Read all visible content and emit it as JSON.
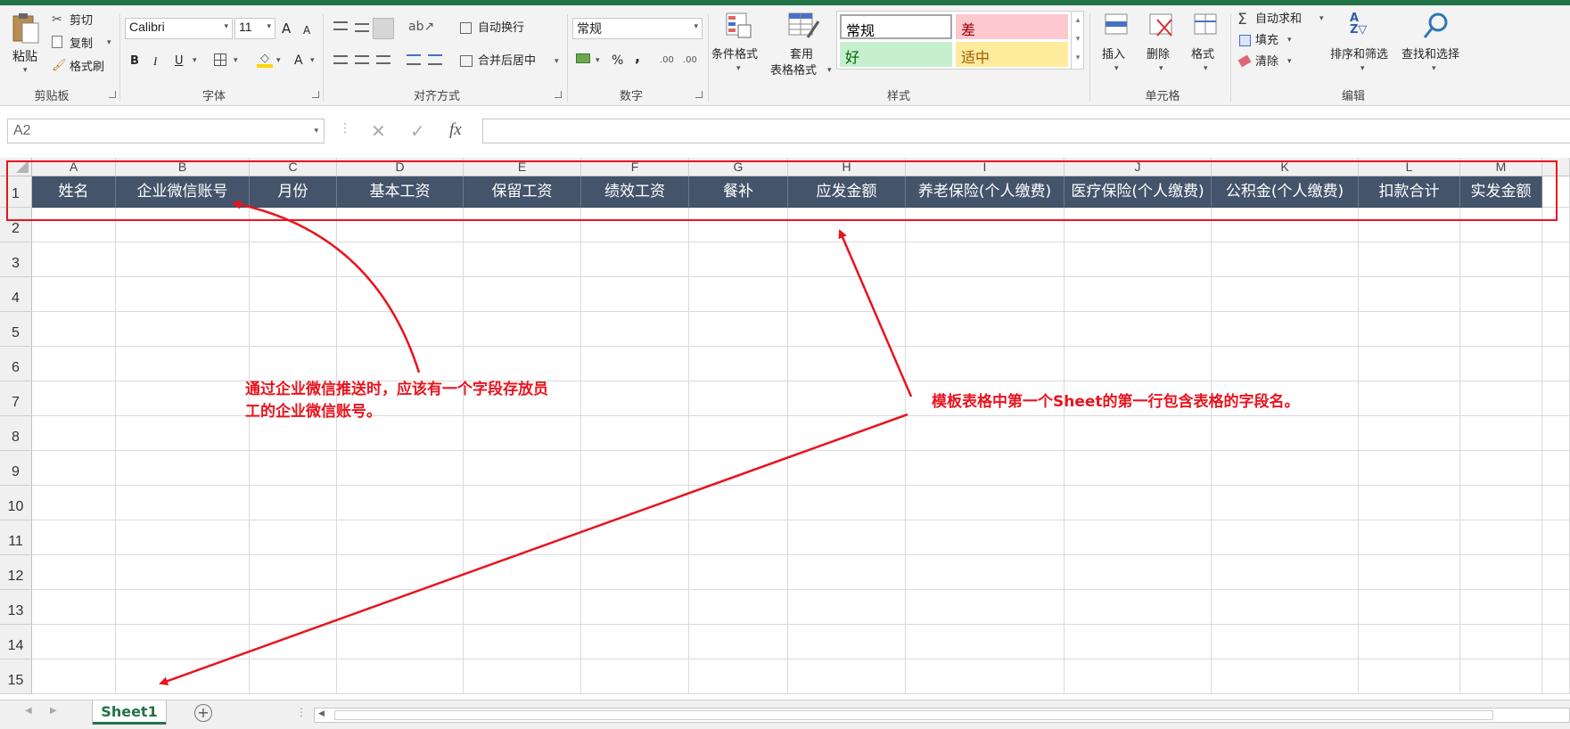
{
  "ribbon": {
    "clipboard": {
      "paste": "粘贴",
      "cut": "剪切",
      "copy": "复制",
      "format_painter": "格式刷",
      "group": "剪贴板"
    },
    "font": {
      "name": "Calibri",
      "size": "11",
      "bold": "B",
      "italic": "I",
      "underline": "U",
      "increase": "A",
      "decrease": "A",
      "font_color": "A",
      "group": "字体"
    },
    "alignment": {
      "wrap": "自动换行",
      "merge": "合并后居中",
      "group": "对齐方式"
    },
    "number": {
      "format": "常规",
      "percent": "%",
      "comma": ",",
      "group": "数字"
    },
    "styles": {
      "conditional": "条件格式",
      "table_format_1": "套用",
      "table_format_2": "表格格式",
      "normal": "常规",
      "bad": "差",
      "good": "好",
      "neutral": "适中",
      "group": "样式"
    },
    "cells": {
      "insert": "插入",
      "delete": "删除",
      "format": "格式",
      "group": "单元格"
    },
    "editing": {
      "autosum": "自动求和",
      "fill": "填充",
      "clear": "清除",
      "sort": "排序和筛选",
      "find": "查找和选择",
      "group": "编辑"
    }
  },
  "formula_bar": {
    "name_box": "A2",
    "fx": "fx",
    "value": ""
  },
  "grid": {
    "columns": [
      "A",
      "B",
      "C",
      "D",
      "E",
      "F",
      "G",
      "H",
      "I",
      "J",
      "K",
      "L",
      "M"
    ],
    "rows": [
      "1",
      "2",
      "3",
      "4",
      "5",
      "6",
      "7",
      "8",
      "9",
      "10",
      "11",
      "12",
      "13",
      "14",
      "15"
    ],
    "header_row": [
      "姓名",
      "企业微信账号",
      "月份",
      "基本工资",
      "保留工资",
      "绩效工资",
      "餐补",
      "应发金额",
      "养老保险(个人缴费)",
      "医疗保险(个人缴费)",
      "公积金(个人缴费)",
      "扣款合计",
      "实发金额"
    ]
  },
  "annotations": {
    "left_line1": "通过企业微信推送时，应该有一个字段存放员",
    "left_line2": "工的企业微信账号。",
    "right": "模板表格中第一个Sheet的第一行包含表格的字段名。"
  },
  "sheets": {
    "active": "Sheet1"
  },
  "colors": {
    "accent": "#217346",
    "header_fill": "#44546a",
    "annotation": "#e8141e",
    "bad_fill": "#ffc7ce",
    "good_fill": "#c6efce",
    "neutral_fill": "#ffeb9c"
  }
}
